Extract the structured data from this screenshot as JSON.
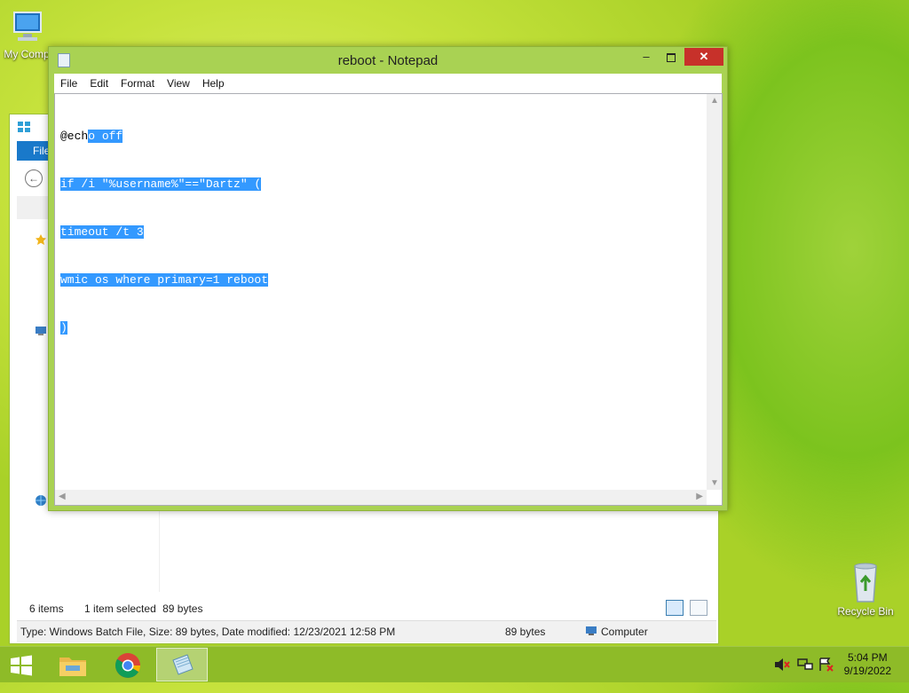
{
  "desktop": {
    "icons": [
      {
        "name": "my-computer",
        "label": "My Comp"
      },
      {
        "name": "recycle-bin",
        "label": "Recycle Bin"
      }
    ]
  },
  "explorer": {
    "ribbon_tab": "File",
    "status_items": "6 items",
    "status_selected": "1 item selected",
    "status_size": "89 bytes",
    "info_type": "Type: Windows Batch File, Size: 89 bytes, Date modified: 12/23/2021 12:58 PM",
    "info_size": "89 bytes",
    "info_location": "Computer"
  },
  "notepad": {
    "title": "reboot - Notepad",
    "minimize": "–",
    "close": "✕",
    "menu": [
      "File",
      "Edit",
      "Format",
      "View",
      "Help"
    ],
    "lines": [
      {
        "plain": "@ech",
        "selected": "o off"
      },
      {
        "plain": "",
        "selected": "if /i \"%username%\"==\"Dartz\" ("
      },
      {
        "plain": "",
        "selected": "timeout /t 3"
      },
      {
        "plain": "",
        "selected": "wmic os where primary=1 reboot"
      },
      {
        "plain": "",
        "selected": ")"
      }
    ]
  },
  "taskbar": {
    "clock_time": "5:04 PM",
    "clock_date": "9/19/2022"
  },
  "colors": {
    "selection": "#3399ff",
    "notepad_frame": "#a9d253",
    "close_button": "#c7312a",
    "taskbar": "#8cb928"
  },
  "icons": [
    "windows-start-icon",
    "file-explorer-icon",
    "chrome-icon",
    "notepad-icon",
    "speaker-muted-icon",
    "network-icon",
    "action-center-icon",
    "recycle-bin-icon",
    "computer-icon"
  ]
}
